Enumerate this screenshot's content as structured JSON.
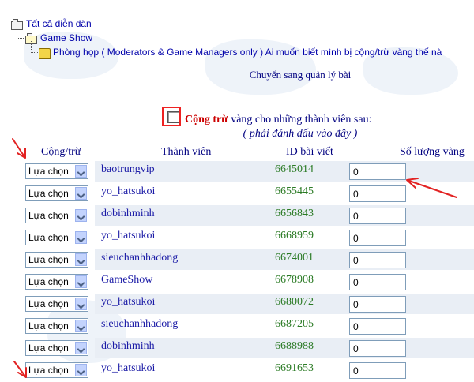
{
  "breadcrumb": [
    {
      "label": "Tất cả diễn đàn",
      "icon": "folder-icon"
    },
    {
      "label": "Game Show",
      "icon": "folder-open-icon"
    },
    {
      "label": "Phòng họp ( Moderators & Game Managers only ) Ai muốn biết mình bị cộng/trừ vàng thế nà",
      "icon": "topic-folder-icon"
    }
  ],
  "page_title": "Chuyển sang quản lý bài",
  "bulk": {
    "checked": false,
    "label_bold": "Cộng trừ",
    "label_rest": " vàng cho những thành viên sau:",
    "hint": "( phải đánh dấu vào đây )"
  },
  "columns": {
    "action": "Cộng/trừ",
    "member": "Thành viên",
    "post_id": "ID bài viết",
    "gold": "Số lượng vàng"
  },
  "select_label": "Lựa chọn",
  "rows": [
    {
      "member": "baotrungvip",
      "post_id": "6645014",
      "gold": "0"
    },
    {
      "member": "yo_hatsukoi",
      "post_id": "6655445",
      "gold": "0"
    },
    {
      "member": "dobinhminh",
      "post_id": "6656843",
      "gold": "0"
    },
    {
      "member": "yo_hatsukoi",
      "post_id": "6668959",
      "gold": "0"
    },
    {
      "member": "sieuchanhhadong",
      "post_id": "6674001",
      "gold": "0"
    },
    {
      "member": "GameShow",
      "post_id": "6678908",
      "gold": "0"
    },
    {
      "member": "yo_hatsukoi",
      "post_id": "6680072",
      "gold": "0"
    },
    {
      "member": "sieuchanhhadong",
      "post_id": "6687205",
      "gold": "0"
    },
    {
      "member": "dobinhminh",
      "post_id": "6688988",
      "gold": "0"
    },
    {
      "member": "yo_hatsukoi",
      "post_id": "6691653",
      "gold": "0"
    }
  ],
  "colors": {
    "link": "#1a1aa6",
    "post_id": "#2a7a24",
    "accent_red": "#cc0000",
    "annotation": "#e22222"
  }
}
